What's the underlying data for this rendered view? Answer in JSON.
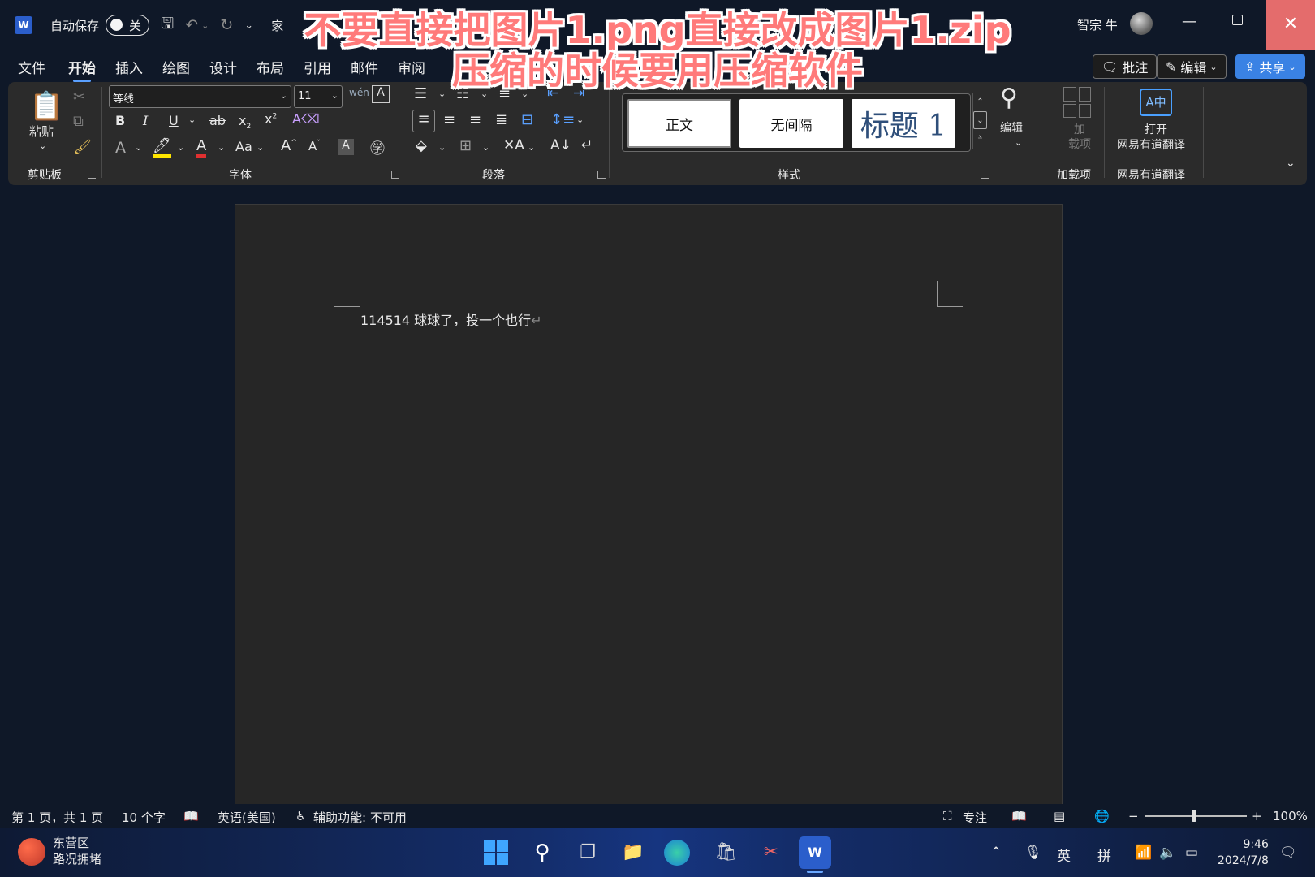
{
  "titlebar": {
    "autosave_label": "自动保存",
    "autosave_state": "关",
    "doc_title": "家",
    "user_name": "智宗 牛"
  },
  "menu": {
    "tabs": [
      "文件",
      "开始",
      "插入",
      "绘图",
      "设计",
      "布局",
      "引用",
      "邮件",
      "审阅"
    ],
    "active_tab": "开始",
    "comment_button": "批注",
    "edit_button": "编辑",
    "share_button": "共享"
  },
  "ribbon": {
    "clipboard": {
      "paste_label": "粘贴",
      "group_label": "剪贴板"
    },
    "font": {
      "font_name": "等线",
      "font_size": "11",
      "group_label": "字体",
      "change_case": "Aa"
    },
    "paragraph": {
      "group_label": "段落"
    },
    "styles": {
      "normal": "正文",
      "no_spacing": "无间隔",
      "heading1": "标题 1",
      "group_label": "样式"
    },
    "editing": {
      "label": "编辑"
    },
    "addins": {
      "label": "加\n载项",
      "group_label": "加载项"
    },
    "youdao": {
      "label_line1": "打开",
      "label_line2": "网易有道翻译",
      "group_label": "网易有道翻译"
    }
  },
  "overlay_caption": {
    "line1": "不要直接把图片1.png直接改成图片1.zip",
    "line2": "压缩的时候要用压缩软件"
  },
  "document": {
    "body_text": "114514 球球了，投一个也行",
    "paragraph_mark": "↵"
  },
  "statusbar": {
    "page_info": "第 1 页，共 1 页",
    "word_count": "10 个字",
    "language": "英语(美国)",
    "accessibility": "辅助功能: 不可用",
    "focus": "专注",
    "zoom": "100%",
    "zoom_minus": "−",
    "zoom_plus": "+"
  },
  "taskbar": {
    "weather_line1": "东营区",
    "weather_line2": "路况拥堵",
    "ime_lang": "英",
    "ime_mode": "拼",
    "time": "9:46",
    "date": "2024/7/8"
  },
  "colors": {
    "background": "#0f1828",
    "ribbon": "#2b2b2b",
    "page": "#262626",
    "accent": "#3a82e4",
    "close_button": "#e46c6c",
    "caption_text": "#ff7a7a"
  },
  "icons": [
    "word-app-icon",
    "save-icon",
    "undo-icon",
    "redo-icon",
    "customize-icon",
    "cut-icon",
    "copy-icon",
    "format-painter-icon",
    "bold-icon",
    "italic-icon",
    "underline-icon",
    "strikethrough-icon",
    "subscript-icon",
    "superscript-icon",
    "clear-format-icon",
    "search-icon",
    "addins-icon",
    "translate-icon",
    "windows-start-icon",
    "file-explorer-icon",
    "edge-icon",
    "store-icon",
    "word-taskbar-icon",
    "wifi-icon",
    "volume-icon",
    "battery-icon",
    "notification-icon"
  ]
}
